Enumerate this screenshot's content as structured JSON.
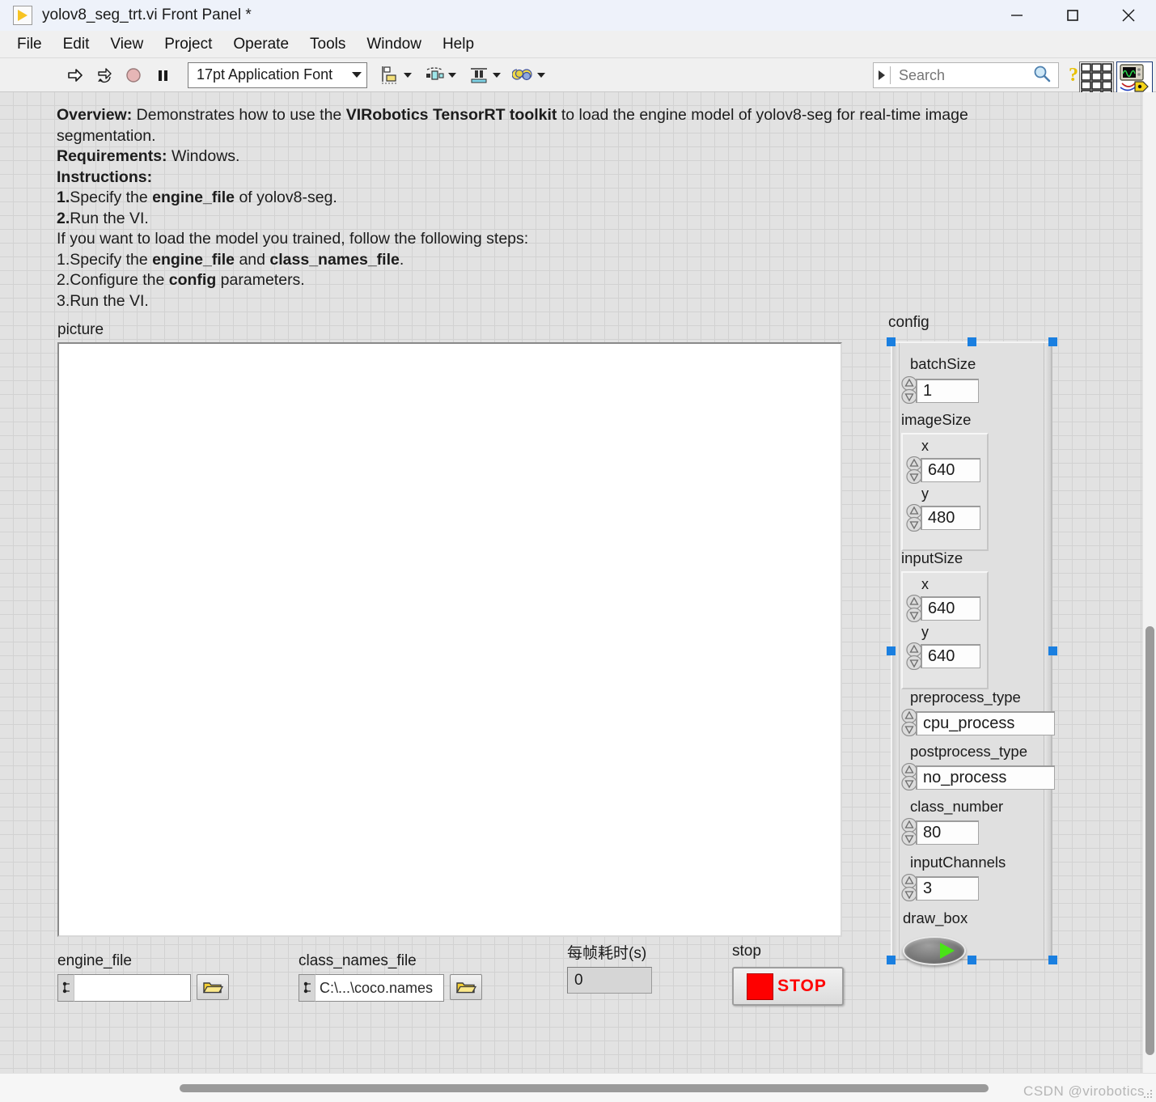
{
  "window": {
    "title": "yolov8_seg_trt.vi Front Panel *",
    "app_icon": "labview-run-icon",
    "minimize_label": "—",
    "maximize_label": "□",
    "close_label": "✕"
  },
  "menubar": {
    "items": [
      {
        "label": "File"
      },
      {
        "label": "Edit"
      },
      {
        "label": "View"
      },
      {
        "label": "Project"
      },
      {
        "label": "Operate"
      },
      {
        "label": "Tools"
      },
      {
        "label": "Window"
      },
      {
        "label": "Help"
      }
    ]
  },
  "toolbar": {
    "run_icon": "run-arrow-icon",
    "run_continuous_icon": "run-continuously-icon",
    "abort_icon": "abort-execution-icon",
    "pause_icon": "pause-icon",
    "font_selector_value": "17pt Application Font",
    "align_icon": "align-objects-icon",
    "distribute_icon": "distribute-objects-icon",
    "resize_icon": "resize-objects-icon",
    "reorder_icon": "reorder-objects-icon",
    "search_placeholder": "Search",
    "search_value": "",
    "search_icon": "magnifier-icon",
    "help_icon": "context-help-icon",
    "grid_icon": "window-grid-icon",
    "vi_icon": "vi-snippet-icon"
  },
  "overview": {
    "line1_bold": "Overview:",
    "line1_text": " Demonstrates how to use the ",
    "line1_bold2": "VIRobotics TensorRT toolkit",
    "line1_text2": " to load the engine model of yolov8-seg for real-time image segmentation.",
    "line2_bold": "Requirements:",
    "line2_text": " Windows.",
    "line3_bold": "Instructions:",
    "line4_num": "1.",
    "line4_text1": "Specify the ",
    "line4_bold": "engine_file",
    "line4_text2": " of yolov8-seg.",
    "line5_num": "2.",
    "line5_text": "Run the VI.",
    "line6_text": "If you want to load the model you trained, follow the following steps:",
    "line7_num": "1.",
    "line7_text1": "Specify the ",
    "line7_bold1": "engine_file",
    "line7_text2": " and ",
    "line7_bold2": "class_names_file",
    "line7_text3": ".",
    "line8_num": "2.",
    "line8_text1": "Configure the ",
    "line8_bold": "config",
    "line8_text2": " parameters.",
    "line9_num": "3.",
    "line9_text": "Run the VI."
  },
  "picture": {
    "label": "picture",
    "content": ""
  },
  "engine_file": {
    "label": "engine_file",
    "value": "",
    "browse_icon": "folder-open-icon",
    "path_icon": "path-terminal-icon"
  },
  "class_names_file": {
    "label": "class_names_file",
    "value": "C:\\...\\coco.names",
    "browse_icon": "folder-open-icon",
    "path_icon": "path-terminal-icon"
  },
  "frame_time": {
    "label": "每帧耗时(s)",
    "value": "0"
  },
  "stop": {
    "label": "stop",
    "button_text": "STOP",
    "color": "#fe0000"
  },
  "config": {
    "label": "config",
    "items": [
      {
        "name": "batchSize",
        "label": "batchSize",
        "value": "1",
        "type": "numeric"
      },
      {
        "name": "imageSize",
        "label": "imageSize",
        "type": "cluster",
        "fields": [
          {
            "label": "x",
            "value": "640"
          },
          {
            "label": "y",
            "value": "480"
          }
        ]
      },
      {
        "name": "inputSize",
        "label": "inputSize",
        "type": "cluster",
        "fields": [
          {
            "label": "x",
            "value": "640"
          },
          {
            "label": "y",
            "value": "640"
          }
        ]
      },
      {
        "name": "preprocess_type",
        "label": "preprocess_type",
        "value": "cpu_process",
        "type": "enum"
      },
      {
        "name": "postprocess_type",
        "label": "postprocess_type",
        "value": "no_process",
        "type": "enum"
      },
      {
        "name": "class_number",
        "label": "class_number",
        "value": "80",
        "type": "numeric"
      },
      {
        "name": "inputChannels",
        "label": "inputChannels",
        "value": "3",
        "type": "numeric"
      },
      {
        "name": "draw_box",
        "label": "draw_box",
        "value": "on",
        "type": "boolean"
      }
    ],
    "selection_handle_color": "#1a7fe0"
  },
  "statusbar": {
    "watermark": "CSDN @virobotics"
  }
}
